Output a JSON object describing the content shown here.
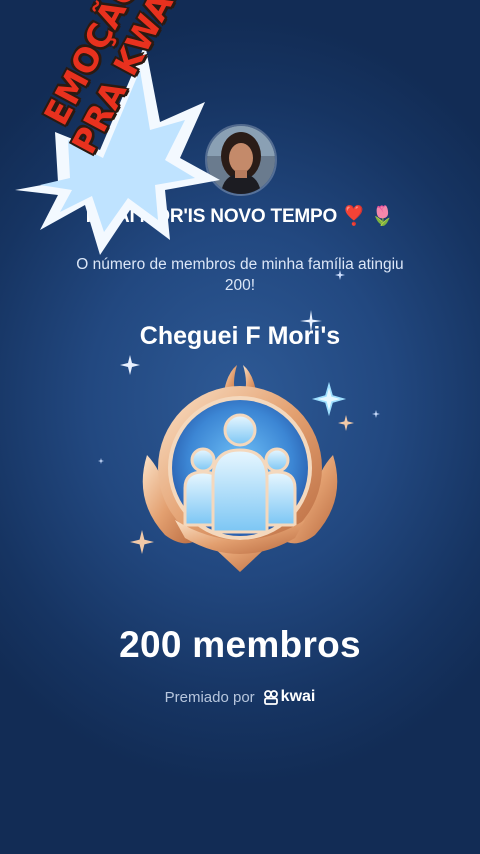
{
  "profile": {
    "avatar_icon": "user-avatar-photo",
    "family_name": "KWAI MOR'IS NOVO TEMPO",
    "emojis": [
      "❣️",
      "🌷"
    ]
  },
  "description": "O número de membros de minha família atingiu 200!",
  "achievement": {
    "title": "Cheguei F Mori's",
    "badge_icon": "family-members-badge-icon",
    "count_label": "200 membros"
  },
  "awarded_by": {
    "prefix": "Premiado por",
    "brand": "kwai",
    "brand_icon": "kwai-logo-icon"
  },
  "sticker": {
    "line1": "EMOÇÃO",
    "line2": "PRA KWAI"
  },
  "colors": {
    "background": "#1c3d6e",
    "sticker_text": "#e8311e",
    "badge_gold": "#e7a77a",
    "badge_blue": "#4a9be0"
  }
}
